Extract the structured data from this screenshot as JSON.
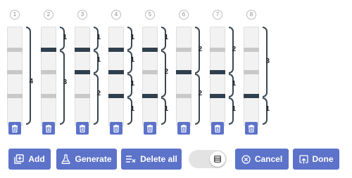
{
  "columns": [
    {
      "number": "1",
      "segments": [
        {
          "label": "4"
        }
      ]
    },
    {
      "number": "2",
      "segments": [
        {
          "label": "1"
        },
        {
          "label": "3"
        }
      ]
    },
    {
      "number": "3",
      "segments": [
        {
          "label": "1"
        },
        {
          "label": "1"
        },
        {
          "label": "2"
        }
      ]
    },
    {
      "number": "4",
      "segments": [
        {
          "label": "1"
        },
        {
          "label": "1"
        },
        {
          "label": "1"
        },
        {
          "label": "1"
        }
      ]
    },
    {
      "number": "5",
      "segments": [
        {
          "label": "1"
        },
        {
          "label": "2"
        },
        {
          "label": "1"
        }
      ]
    },
    {
      "number": "6",
      "segments": [
        {
          "label": "2"
        },
        {
          "label": "2"
        }
      ]
    },
    {
      "number": "7",
      "segments": [
        {
          "label": "2"
        },
        {
          "label": "1"
        },
        {
          "label": "1"
        }
      ]
    },
    {
      "number": "8",
      "segments": [
        {
          "label": "3"
        },
        {
          "label": "1"
        }
      ]
    }
  ],
  "column_icon": "trash-icon",
  "buttons": {
    "add": {
      "label": "Add",
      "icon": "add-to-queue-icon"
    },
    "generate": {
      "label": "Generate",
      "icon": "flask-icon"
    },
    "delete_all": {
      "label": "Delete all",
      "icon": "clear-all-icon"
    },
    "cancel": {
      "label": "Cancel",
      "icon": "cancel-circle-icon"
    },
    "done": {
      "label": "Done",
      "icon": "done-icon"
    }
  },
  "toggle": {
    "state": "on",
    "icon": "list-icon"
  },
  "colors": {
    "accent": "#5c73c9",
    "dark_marker": "#2f3f4d",
    "light_marker": "#c8c8c8",
    "bar": "#f2f2f2"
  }
}
